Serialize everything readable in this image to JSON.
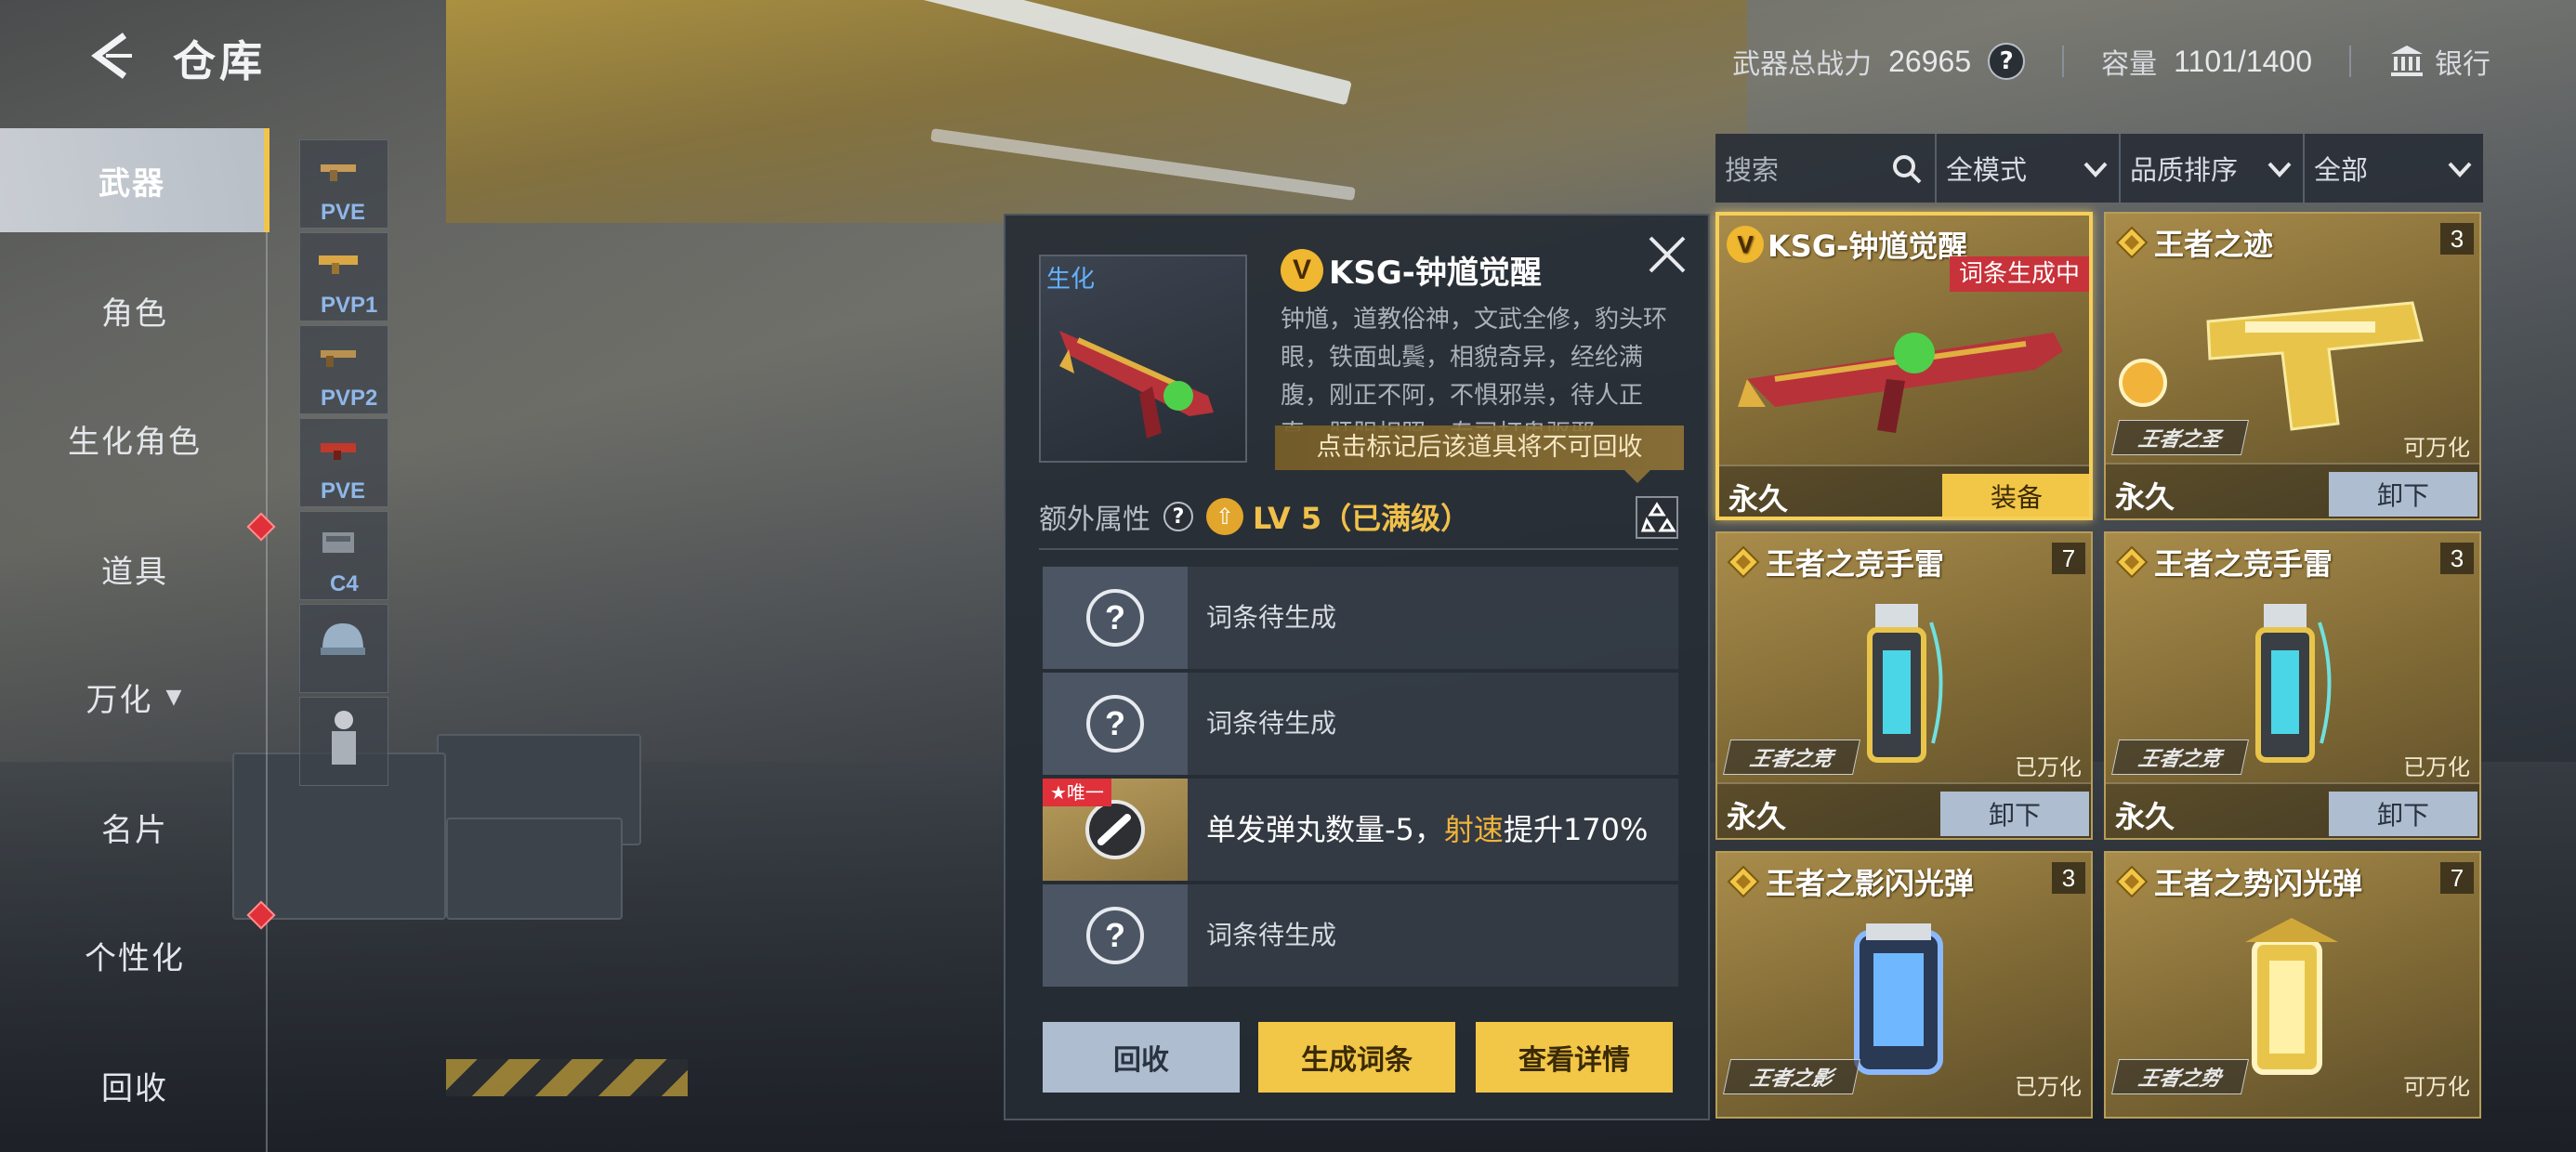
{
  "header": {
    "title": "仓库",
    "power_label": "武器总战力",
    "power_value": "26965",
    "capacity_label": "容量",
    "capacity_value": "1101/1400",
    "bank_label": "银行"
  },
  "sidebar": {
    "items": [
      {
        "label": "武器",
        "active": true
      },
      {
        "label": "角色"
      },
      {
        "label": "生化角色"
      },
      {
        "label": "道具",
        "badge": true
      },
      {
        "label": "万化"
      },
      {
        "label": "名片"
      },
      {
        "label": "个性化",
        "badge": true
      },
      {
        "label": "回收"
      }
    ]
  },
  "thumbs": [
    "PVE",
    "PVP1",
    "PVP2",
    "PVE",
    "C4"
  ],
  "popup": {
    "tag": "生化",
    "badge": "V",
    "title": "KSG-钟馗觉醒",
    "description": "钟馗，道教俗神，文武全修，豹头环眼，铁面虬鬓，相貌奇异，经纶满腹，刚正不阿，不惧邪祟，待人正直，肝胆相照，专司打鬼驱邪",
    "tooltip": "点击标记后该道具将不可回收",
    "attr_label": "额外属性",
    "level_text": "LV 5（已满级）",
    "slots": [
      {
        "text": "词条待生成"
      },
      {
        "text": "词条待生成"
      },
      {
        "unique_tag": "★唯一",
        "text_a": "单发弹丸数量-5，",
        "text_hl": "射速",
        "text_b": "提升170%"
      },
      {
        "text": "词条待生成"
      }
    ],
    "buttons": {
      "recycle": "回收",
      "generate": "生成词条",
      "details": "查看详情"
    }
  },
  "filters": {
    "search_placeholder": "搜索",
    "mode": "全模式",
    "sort": "品质排序",
    "scope": "全部"
  },
  "cards": [
    {
      "name": "KSG-钟馗觉醒",
      "badge": "V",
      "gen_tag": "词条生成中",
      "perm": "永久",
      "action": "装备"
    },
    {
      "name": "王者之迹",
      "count": "3",
      "plate": "王者之圣",
      "status": "可万化",
      "perm": "永久",
      "action": "卸下"
    },
    {
      "name": "王者之竞手雷",
      "count": "7",
      "plate": "王者之竞",
      "status": "已万化",
      "perm": "永久",
      "action": "卸下"
    },
    {
      "name": "王者之竞手雷",
      "count": "3",
      "plate": "王者之竞",
      "status": "已万化",
      "perm": "永久",
      "action": "卸下"
    },
    {
      "name": "王者之影闪光弹",
      "count": "3",
      "plate": "王者之影",
      "status": "已万化"
    },
    {
      "name": "王者之势闪光弹",
      "count": "7",
      "plate": "王者之势",
      "status": "可万化"
    }
  ],
  "colors": {
    "accent_gold": "#f2c646",
    "button_gray": "#aebdd0",
    "alert_red": "#c8323a",
    "level_gold": "#f0c04a"
  }
}
